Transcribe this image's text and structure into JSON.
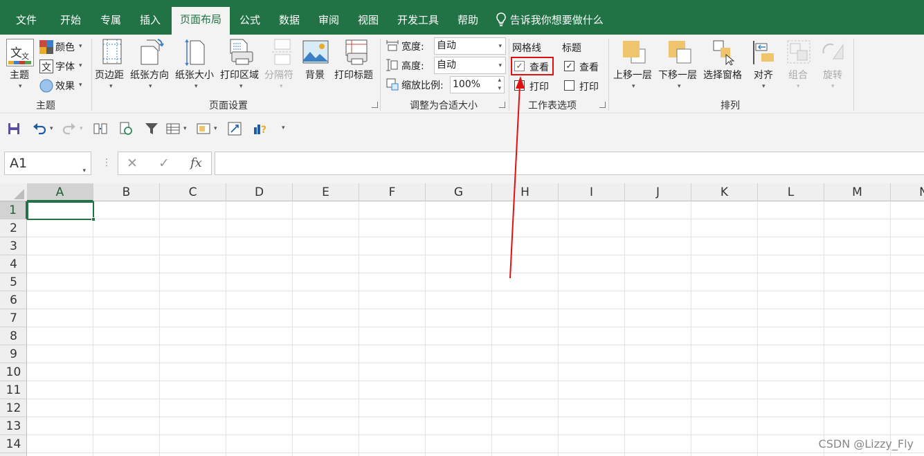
{
  "tabs": [
    "文件",
    "开始",
    "专属",
    "插入",
    "页面布局",
    "公式",
    "数据",
    "审阅",
    "视图",
    "开发工具",
    "帮助"
  ],
  "tell_me": "告诉我你想要做什么",
  "theme_group": {
    "themes_label": "主题",
    "colors_label": "颜色",
    "fonts_label": "字体",
    "effects_label": "效果",
    "group_label": "主题"
  },
  "page_setup": {
    "margins": "页边距",
    "orientation": "纸张方向",
    "size": "纸张大小",
    "print_area": "打印区域",
    "breaks": "分隔符",
    "background": "背景",
    "print_titles": "打印标题",
    "group_label": "页面设置"
  },
  "scale_to_fit": {
    "width_label": "宽度:",
    "width_value": "自动",
    "height_label": "高度:",
    "height_value": "自动",
    "scale_label": "缩放比例:",
    "scale_value": "100%",
    "group_label": "调整为合适大小"
  },
  "sheet_options": {
    "gridlines_label": "网格线",
    "gridlines_view": "查看",
    "gridlines_print": "打印",
    "headings_label": "标题",
    "headings_view": "查看",
    "headings_print": "打印",
    "group_label": "工作表选项"
  },
  "arrange": {
    "bring_forward": "上移一层",
    "send_backward": "下移一层",
    "selection_pane": "选择窗格",
    "align": "对齐",
    "group": "组合",
    "rotate": "旋转",
    "group_label": "排列"
  },
  "formula_bar": {
    "name_box": "A1",
    "cancel": "✕",
    "enter": "✓",
    "fx": "fx",
    "value": ""
  },
  "columns": [
    "A",
    "B",
    "C",
    "D",
    "E",
    "F",
    "G",
    "H",
    "I",
    "J",
    "K",
    "L",
    "M",
    "N"
  ],
  "rows": [
    "1",
    "2",
    "3",
    "4",
    "5",
    "6",
    "7",
    "8",
    "9",
    "10",
    "11",
    "12",
    "13",
    "14"
  ],
  "watermark": "CSDN @Lizzy_Fly",
  "colors": {
    "accent": "#217346",
    "highlight": "#e01010"
  }
}
